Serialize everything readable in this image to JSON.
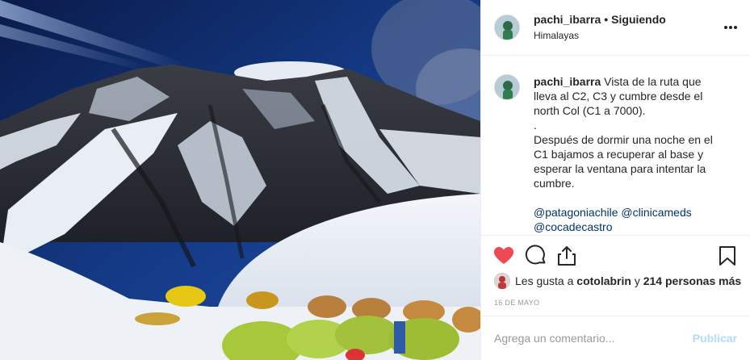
{
  "post": {
    "image_description_icon": "mountain-photo",
    "username": "pachi_ibarra",
    "separator": "•",
    "follow_status": "Siguiendo",
    "location": "Himalayas",
    "more_icon": "more-options-icon"
  },
  "caption": {
    "username": "pachi_ibarra",
    "line1": "Vista de la ruta que lleva al C2, C3 y cumbre desde el north Col (C1 a 7000).",
    "dot": ".",
    "line2": "Después de dormir una noche en el C1 bajamos a recuperar al base y esperar la ventana para intentar la cumbre.",
    "tag1": "@patagoniachile",
    "tag2": "@clinicameds",
    "tag3": "@cocadecastro"
  },
  "actions": {
    "like_icon": "heart-icon",
    "comment_icon": "comment-icon",
    "share_icon": "share-icon",
    "save_icon": "bookmark-icon",
    "liked": true,
    "like_color": "#ed4956"
  },
  "likes": {
    "prefix": "Les gusta a",
    "user": "cotolabrin",
    "conj": "y",
    "others": "214 personas más"
  },
  "date": "16 DE MAYO",
  "comment_box": {
    "placeholder": "Agrega un comentario...",
    "publish_label": "Publicar"
  }
}
